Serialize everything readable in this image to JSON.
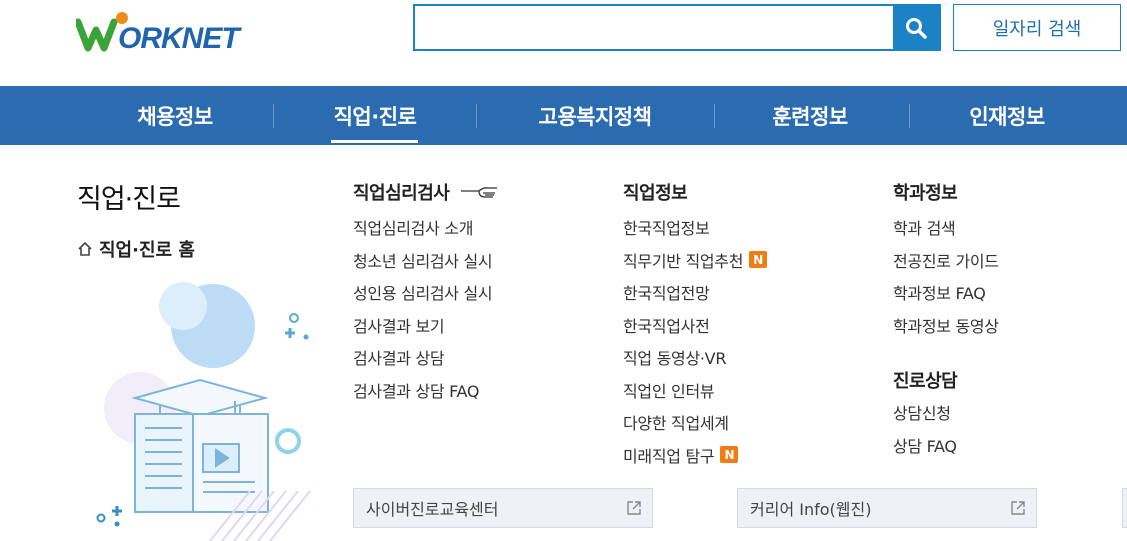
{
  "header": {
    "logo_text": "WORKNET",
    "search_placeholder": "",
    "job_search_label": "일자리 검색"
  },
  "nav": {
    "items": [
      "채용정보",
      "직업·진로",
      "고용복지정책",
      "훈련정보",
      "인재정보"
    ],
    "active": "직업·진로"
  },
  "left": {
    "title": "직업·진로",
    "home_link": "직업·진로 홈"
  },
  "col1": {
    "title": "직업심리검사",
    "links": [
      "직업심리검사 소개",
      "청소년 심리검사 실시",
      "성인용 심리검사 실시",
      "검사결과 보기",
      "검사결과 상담",
      "검사결과 상담 FAQ"
    ]
  },
  "col2": {
    "title": "직업정보",
    "links": [
      "한국직업정보",
      "직무기반 직업추천",
      "한국직업전망",
      "한국직업사전",
      "직업 동영상·VR",
      "직업인 인터뷰",
      "다양한 직업세계",
      "미래직업 탐구"
    ],
    "badge": "N"
  },
  "col3": {
    "title": "학과정보",
    "links": [
      "학과 검색",
      "전공진로 가이드",
      "학과정보 FAQ",
      "학과정보 동영상"
    ],
    "title2": "진로상담",
    "links2": [
      "상담신청",
      "상담 FAQ"
    ]
  },
  "bottom": {
    "cyber": "사이버진로교육센터",
    "career": "커리어 Info(웹진)"
  },
  "colors": {
    "nav_bg": "#2b6cb0",
    "accent": "#1c82c6",
    "badge": "#f07c14"
  }
}
